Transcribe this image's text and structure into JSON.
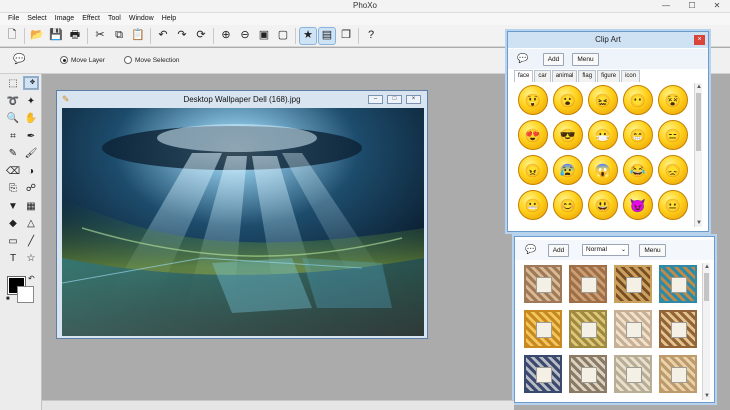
{
  "app": {
    "title": "PhoXo",
    "window_buttons": [
      "—",
      "☐",
      "✕"
    ]
  },
  "menu": [
    "File",
    "Select",
    "Image",
    "Effect",
    "Tool",
    "Window",
    "Help"
  ],
  "toolbar": {
    "buttons": [
      {
        "icon": "new-icon",
        "glyph": "🗋"
      },
      {
        "icon": "open-icon",
        "glyph": "📂"
      },
      {
        "icon": "save-icon",
        "glyph": "💾"
      },
      {
        "icon": "print-icon",
        "glyph": "🖶"
      },
      {
        "icon": "cut-icon",
        "glyph": "✂"
      },
      {
        "icon": "copy-icon",
        "glyph": "⧉"
      },
      {
        "icon": "paste-icon",
        "glyph": "📋"
      },
      {
        "icon": "undo-icon",
        "glyph": "↶"
      },
      {
        "icon": "redo-icon",
        "glyph": "↷"
      },
      {
        "icon": "refresh-icon",
        "glyph": "⟳"
      },
      {
        "icon": "zoom-in-icon",
        "glyph": "⊕"
      },
      {
        "icon": "zoom-out-icon",
        "glyph": "⊖"
      },
      {
        "icon": "actual-size-icon",
        "glyph": "▣"
      },
      {
        "icon": "fit-window-icon",
        "glyph": "▢"
      },
      {
        "icon": "clip-art-icon",
        "glyph": "★",
        "active": true
      },
      {
        "icon": "frame-icon",
        "glyph": "▤",
        "active": true
      },
      {
        "icon": "layers-icon",
        "glyph": "❐"
      },
      {
        "icon": "help-icon",
        "glyph": "?"
      }
    ]
  },
  "options": {
    "move_layer_label": "Move Layer",
    "move_selection_label": "Move Selection",
    "selected": "Move Layer"
  },
  "tools": [
    {
      "name": "rect-select-icon",
      "glyph": "⬚"
    },
    {
      "name": "move-icon",
      "glyph": "✥",
      "selected": true
    },
    {
      "name": "lasso-icon",
      "glyph": "➰"
    },
    {
      "name": "magic-wand-icon",
      "glyph": "✦"
    },
    {
      "name": "zoom-tool-icon",
      "glyph": "🔍"
    },
    {
      "name": "hand-icon",
      "glyph": "✋"
    },
    {
      "name": "crop-icon",
      "glyph": "⌗"
    },
    {
      "name": "eyedropper-icon",
      "glyph": "✒"
    },
    {
      "name": "pencil-icon",
      "glyph": "✎"
    },
    {
      "name": "brush-icon",
      "glyph": "🖌"
    },
    {
      "name": "eraser-icon",
      "glyph": "⌫"
    },
    {
      "name": "contrast-icon",
      "glyph": "◑"
    },
    {
      "name": "clone-icon",
      "glyph": "⎘"
    },
    {
      "name": "smudge-icon",
      "glyph": "☍"
    },
    {
      "name": "fill-icon",
      "glyph": "▼"
    },
    {
      "name": "gradient-icon",
      "glyph": "▦"
    },
    {
      "name": "shape-icon",
      "glyph": "◆"
    },
    {
      "name": "sharpen-icon",
      "glyph": "△"
    },
    {
      "name": "rectangle-icon",
      "glyph": "▭"
    },
    {
      "name": "line-icon",
      "glyph": "╱"
    },
    {
      "name": "text-icon",
      "glyph": "T"
    },
    {
      "name": "star-tool-icon",
      "glyph": "☆"
    }
  ],
  "colors": {
    "foreground": "#000000",
    "background": "#ffffff"
  },
  "document": {
    "title": "Desktop Wallpaper Dell (168).jpg",
    "buttons": [
      "–",
      "□",
      "×"
    ]
  },
  "clipart": {
    "title": "Clip Art",
    "close": "×",
    "add_label": "Add",
    "menu_label": "Menu",
    "tabs": [
      "face",
      "car",
      "animal",
      "flag",
      "figure",
      "icon"
    ],
    "active_tab": "face",
    "emoticons": [
      "😲",
      "😮",
      "😖",
      "😶",
      "😵",
      "😍",
      "😎",
      "😷",
      "😁",
      "😑",
      "😠",
      "😰",
      "😱",
      "😂",
      "😞",
      "😬",
      "😊",
      "😃",
      "😈",
      "😐"
    ]
  },
  "frames": {
    "add_label": "Add",
    "mode_value": "Normal",
    "menu_label": "Menu",
    "items": [
      {
        "outer": "#a07a58",
        "inner": "#d8bb94"
      },
      {
        "outer": "#a06f48",
        "inner": "#c99f73"
      },
      {
        "outer": "#c9a15e",
        "inner": "#7a4d22"
      },
      {
        "outer": "#2f8aa6",
        "inner": "#c38a46"
      },
      {
        "outer": "#c88a1f",
        "inner": "#f2c761"
      },
      {
        "outer": "#a08a3f",
        "inner": "#ddc779"
      },
      {
        "outer": "#c8b096",
        "inner": "#f0e2cc"
      },
      {
        "outer": "#93643a",
        "inner": "#e4c48d"
      },
      {
        "outer": "#3a4a6e",
        "inner": "#b9bcc5"
      },
      {
        "outer": "#8a7a66",
        "inner": "#dcd2c2"
      },
      {
        "outer": "#b9ad95",
        "inner": "#e9e1cf"
      },
      {
        "outer": "#bf9a6b",
        "inner": "#e9d3ac"
      }
    ]
  }
}
